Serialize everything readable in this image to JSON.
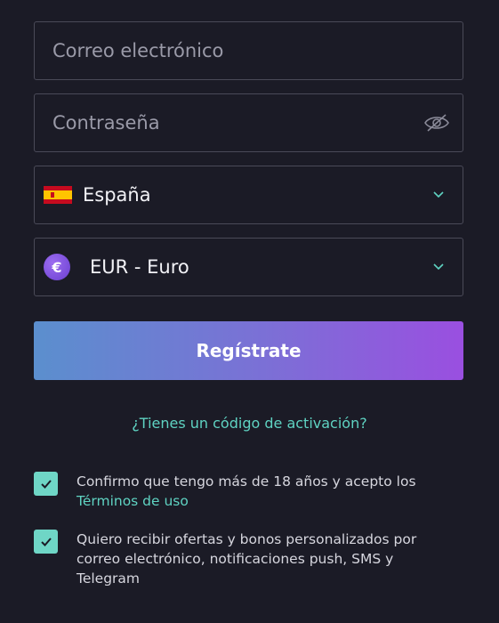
{
  "form": {
    "email_placeholder": "Correo electrónico",
    "password_placeholder": "Contraseña",
    "country": {
      "value": "España",
      "flag_icon": "spain-flag-icon"
    },
    "currency": {
      "value": "EUR - Euro",
      "symbol": "€"
    },
    "register_label": "Regístrate",
    "activation_link": "¿Tienes un código de activación?"
  },
  "consents": [
    {
      "checked": true,
      "text": "Confirmo que tengo más de 18 años y acepto los",
      "link": "Términos de uso"
    },
    {
      "checked": true,
      "text": "Quiero recibir ofertas y bonos personalizados por correo electrónico, notificaciones push, SMS y Telegram"
    }
  ],
  "colors": {
    "background": "#1b1b26",
    "accent_teal": "#5fd3c2",
    "button_gradient_start": "#5b8fce",
    "button_gradient_end": "#9a4fe0",
    "checkbox": "#6fd6c6"
  },
  "icons": {
    "password_toggle": "eye-slash-icon",
    "dropdown": "chevron-down-icon",
    "checkmark": "check-icon"
  }
}
